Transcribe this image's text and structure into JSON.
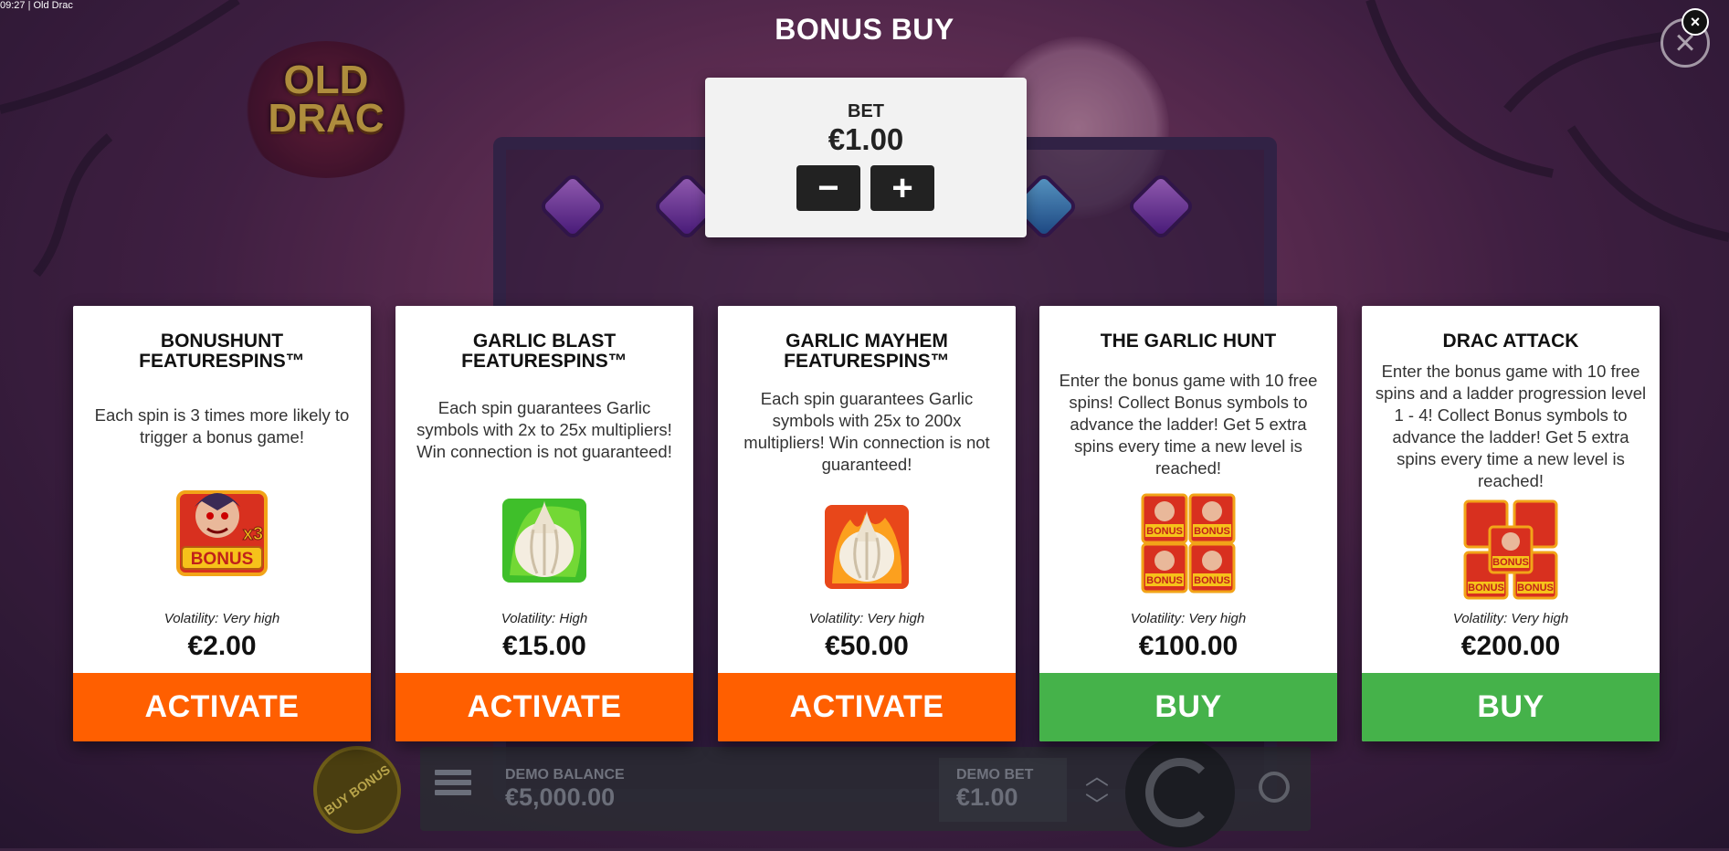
{
  "header": {
    "time_title": "09:27 | Old Drac"
  },
  "background": {
    "logo_text": "OLD DRAC"
  },
  "modal": {
    "title": "BONUS BUY",
    "close_icon": "close-icon"
  },
  "bet": {
    "label": "BET",
    "value": "€1.00",
    "minus": "−",
    "plus": "+"
  },
  "cards": [
    {
      "title": "BONUSHUNT FEATURESPINS™",
      "description": "Each spin is 3 times more likely to trigger a bonus game!",
      "image_text": "BONUS",
      "image_badge": "x3",
      "volatility": "Volatility: Very high",
      "price": "€2.00",
      "action": "ACTIVATE",
      "action_color": "#ff5f00"
    },
    {
      "title": "GARLIC BLAST FEATURESPINS™",
      "description": "Each spin guarantees Garlic symbols with 2x to 25x multipliers! Win connection is not guaranteed!",
      "volatility": "Volatility: High",
      "price": "€15.00",
      "action": "ACTIVATE",
      "action_color": "#ff5f00"
    },
    {
      "title": "GARLIC MAYHEM FEATURESPINS™",
      "description": "Each spin guarantees Garlic symbols with 25x to 200x multipliers! Win connection is not guaranteed!",
      "volatility": "Volatility: Very high",
      "price": "€50.00",
      "action": "ACTIVATE",
      "action_color": "#ff5f00"
    },
    {
      "title": "THE GARLIC HUNT",
      "description": "Enter the bonus game with 10 free spins! Collect Bonus symbols to advance the ladder! Get 5 extra spins every time a new level is reached!",
      "image_text": "BONUS",
      "volatility": "Volatility: Very high",
      "price": "€100.00",
      "action": "BUY",
      "action_color": "#45b24a"
    },
    {
      "title": "DRAC ATTACK",
      "description": "Enter the bonus game with 10 free spins and a ladder progression level 1 - 4! Collect Bonus symbols to advance the ladder! Get 5 extra spins every time a new level is reached!",
      "image_text": "BONUS",
      "volatility": "Volatility: Very high",
      "price": "€200.00",
      "action": "BUY",
      "action_color": "#45b24a"
    }
  ],
  "footer": {
    "buy_bonus": "BUY BONUS",
    "demo_balance_label": "DEMO BALANCE",
    "demo_balance_value": "€5,000.00",
    "demo_bet_label": "DEMO BET",
    "demo_bet_value": "€1.00"
  }
}
